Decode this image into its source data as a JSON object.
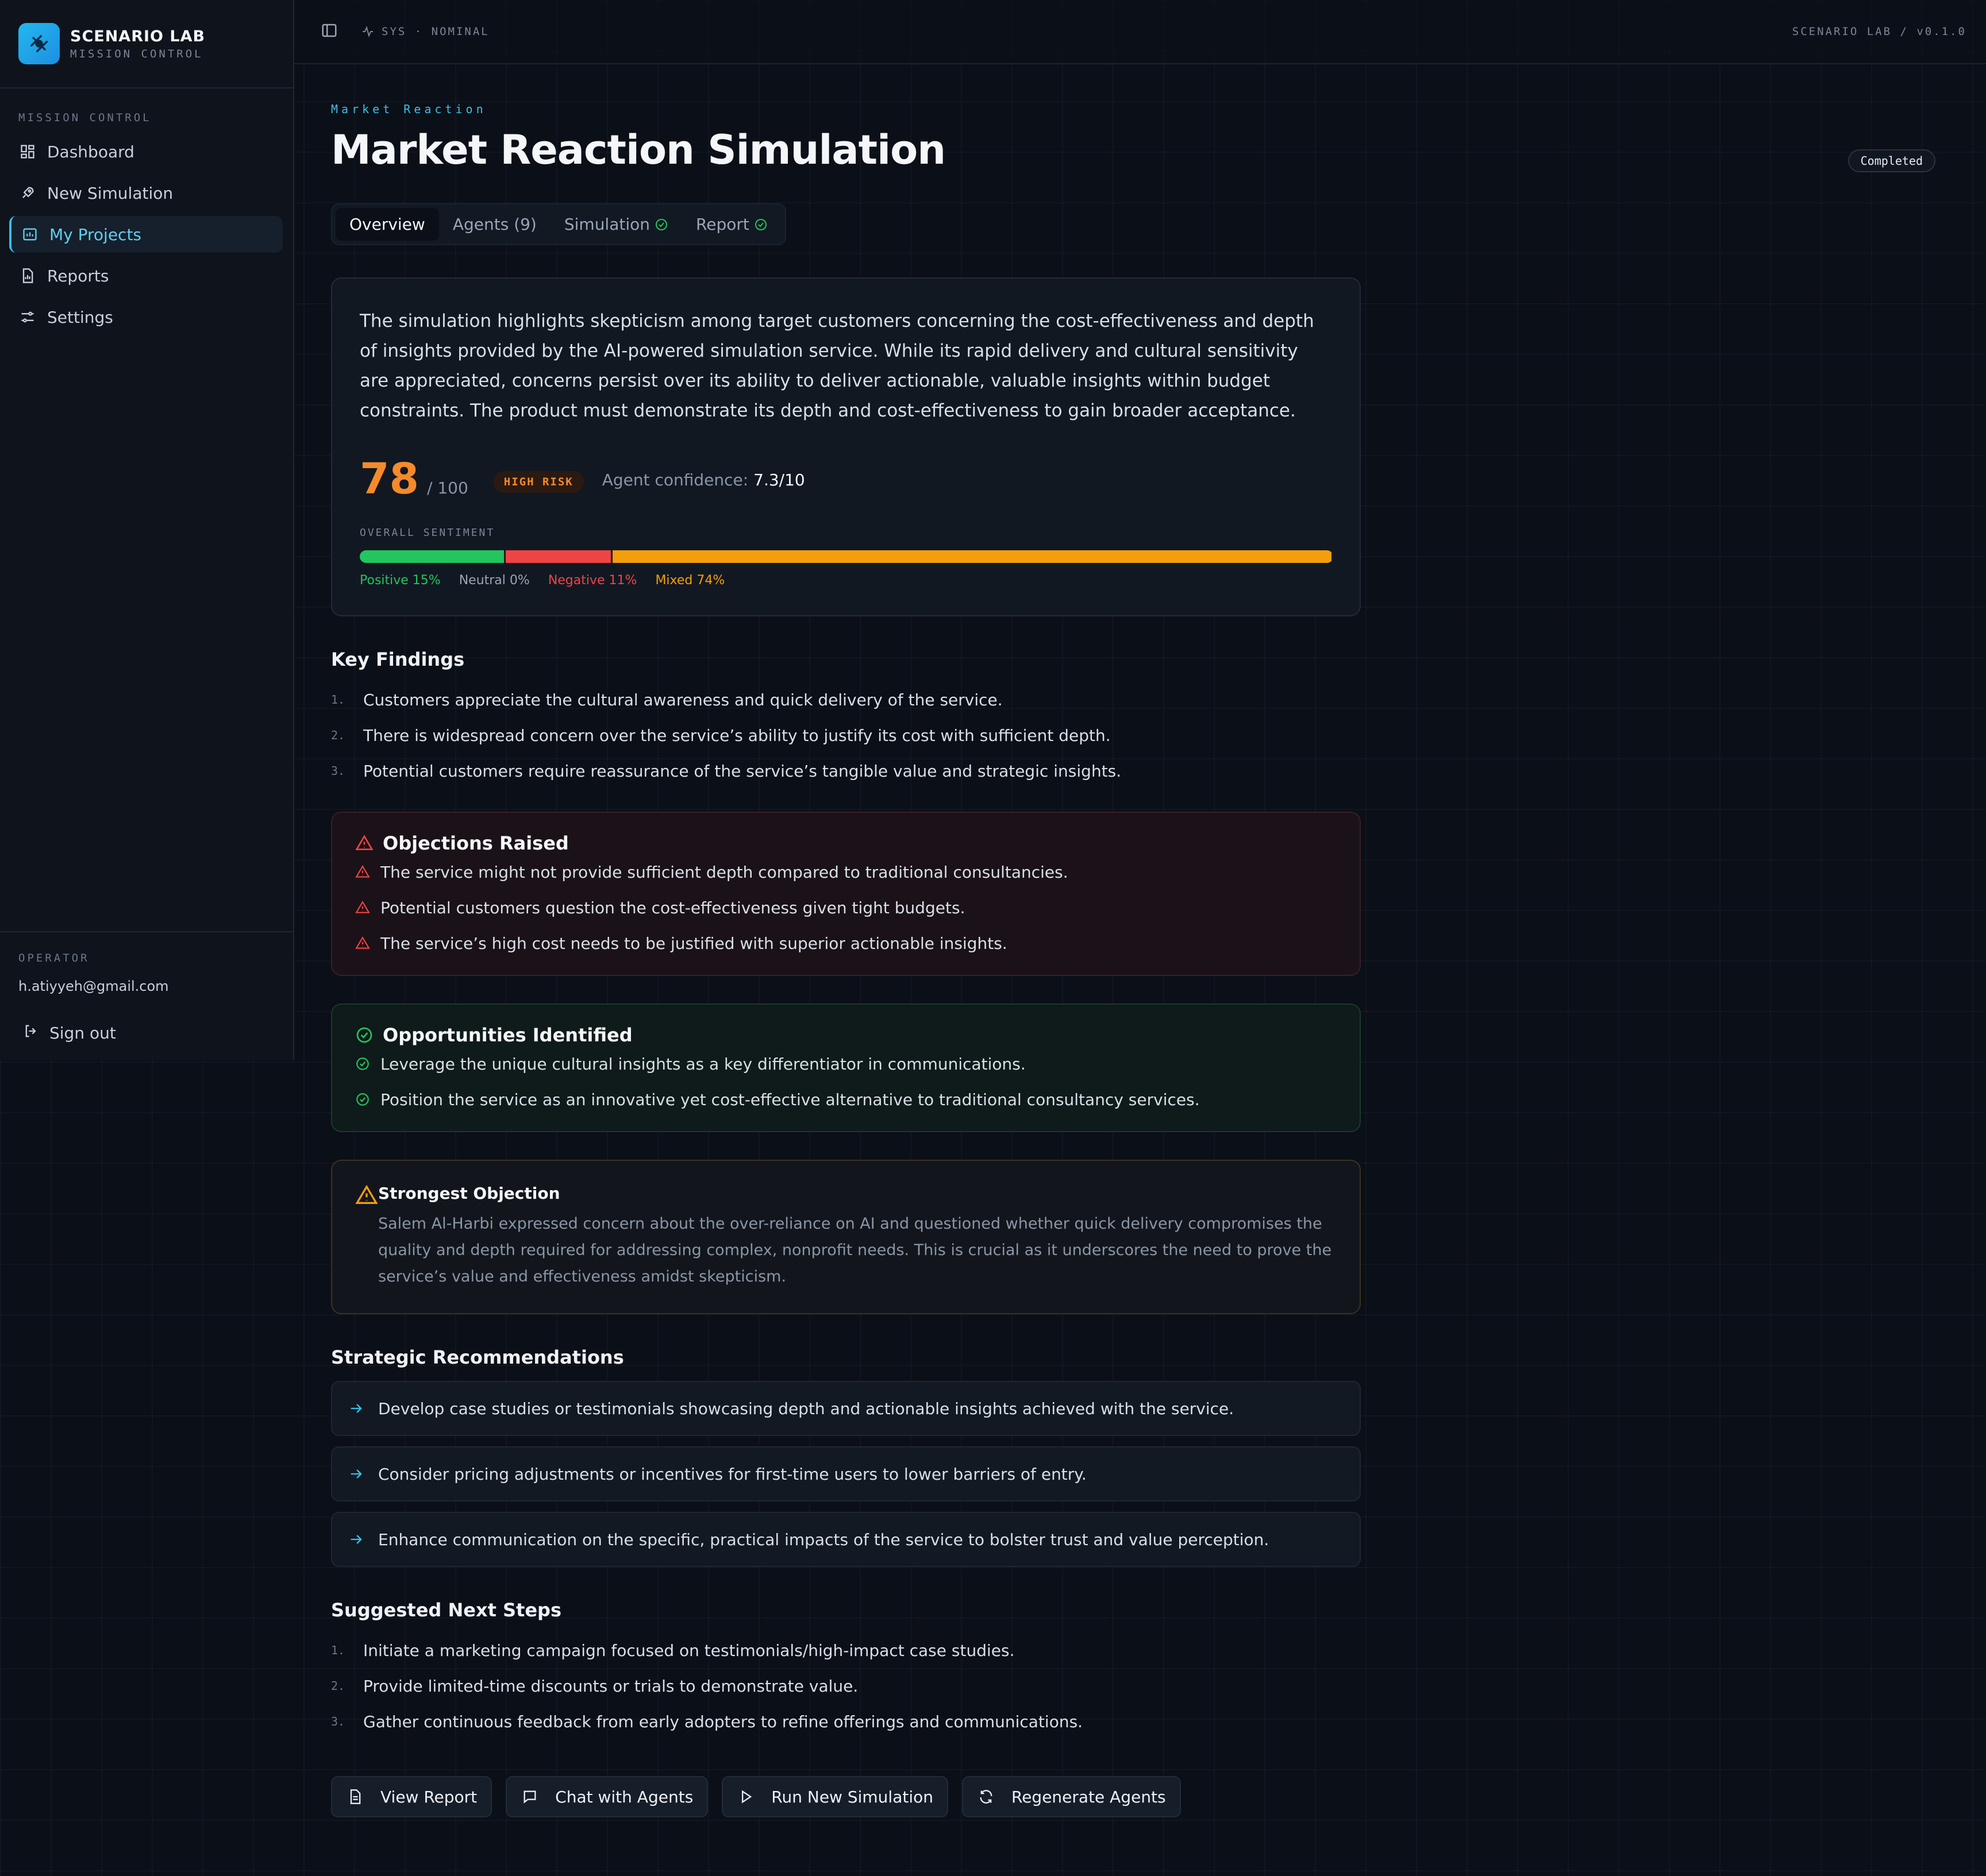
{
  "brand": {
    "name": "SCENARIO LAB",
    "subtitle": "MISSION CONTROL"
  },
  "sidebar": {
    "heading": "MISSION CONTROL",
    "items": [
      {
        "label": "Dashboard",
        "icon": "dashboard-icon"
      },
      {
        "label": "New Simulation",
        "icon": "rocket-icon"
      },
      {
        "label": "My Projects",
        "icon": "projects-icon",
        "active": true
      },
      {
        "label": "Reports",
        "icon": "report-icon"
      },
      {
        "label": "Settings",
        "icon": "settings-icon"
      }
    ],
    "operator_label": "OPERATOR",
    "operator_email": "h.atiyyeh@gmail.com",
    "signout": "Sign out"
  },
  "topbar": {
    "status": "SYS · NOMINAL",
    "version": "SCENARIO LAB / v0.1.0"
  },
  "page": {
    "breadcrumb": "Market Reaction",
    "title": "Market Reaction Simulation",
    "status": "Completed"
  },
  "tabs": [
    {
      "label": "Overview",
      "active": true
    },
    {
      "label": "Agents (9)"
    },
    {
      "label": "Simulation",
      "check": true
    },
    {
      "label": "Report",
      "check": true
    }
  ],
  "summary": {
    "text": "The simulation highlights skepticism among target customers concerning the cost-effectiveness and depth of insights provided by the AI-powered simulation service. While its rapid delivery and cultural sensitivity are appreciated, concerns persist over its ability to deliver actionable, valuable insights within budget constraints. The product must demonstrate its depth and cost-effectiveness to gain broader acceptance.",
    "score": "78",
    "score_max": "/ 100",
    "risk": "HIGH RISK",
    "confidence_label": "Agent confidence:",
    "confidence_value": "7.3/10",
    "sentiment_label": "OVERALL SENTIMENT",
    "sentiment": [
      {
        "label": "Positive 15%",
        "pct": 15,
        "color": "#22c55e"
      },
      {
        "label": "Neutral 0%",
        "pct": 0,
        "color": "#9aa5b5"
      },
      {
        "label": "Negative 11%",
        "pct": 11,
        "color": "#ef4444"
      },
      {
        "label": "Mixed 74%",
        "pct": 74,
        "color": "#f59e0b"
      }
    ]
  },
  "key_findings": {
    "title": "Key Findings",
    "items": [
      "Customers appreciate the cultural awareness and quick delivery of the service.",
      "There is widespread concern over the service’s ability to justify its cost with sufficient depth.",
      "Potential customers require reassurance of the service’s tangible value and strategic insights."
    ]
  },
  "objections": {
    "title": "Objections Raised",
    "items": [
      "The service might not provide sufficient depth compared to traditional consultancies.",
      "Potential customers question the cost-effectiveness given tight budgets.",
      "The service’s high cost needs to be justified with superior actionable insights."
    ]
  },
  "opportunities": {
    "title": "Opportunities Identified",
    "items": [
      "Leverage the unique cultural insights as a key differentiator in communications.",
      "Position the service as an innovative yet cost-effective alternative to traditional consultancy services."
    ]
  },
  "strongest_objection": {
    "title": "Strongest Objection",
    "text": "Salem Al-Harbi expressed concern about the over-reliance on AI and questioned whether quick delivery compromises the quality and depth required for addressing complex, nonprofit needs. This is crucial as it underscores the need to prove the service’s value and effectiveness amidst skepticism."
  },
  "recommendations": {
    "title": "Strategic Recommendations",
    "items": [
      "Develop case studies or testimonials showcasing depth and actionable insights achieved with the service.",
      "Consider pricing adjustments or incentives for first-time users to lower barriers of entry.",
      "Enhance communication on the specific, practical impacts of the service to bolster trust and value perception."
    ]
  },
  "next_steps": {
    "title": "Suggested Next Steps",
    "items": [
      "Initiate a marketing campaign focused on testimonials/high-impact case studies.",
      "Provide limited-time discounts or trials to demonstrate value.",
      "Gather continuous feedback from early adopters to refine offerings and communications."
    ]
  },
  "actions": [
    {
      "label": "View Report",
      "icon": "document-icon"
    },
    {
      "label": "Chat with Agents",
      "icon": "chat-icon"
    },
    {
      "label": "Run New Simulation",
      "icon": "play-icon"
    },
    {
      "label": "Regenerate Agents",
      "icon": "refresh-icon"
    }
  ],
  "colors": {
    "accent": "#36c0ea",
    "score": "#f58a2a",
    "danger": "#ef4444",
    "success": "#22c55e",
    "warning": "#f59e0b"
  }
}
